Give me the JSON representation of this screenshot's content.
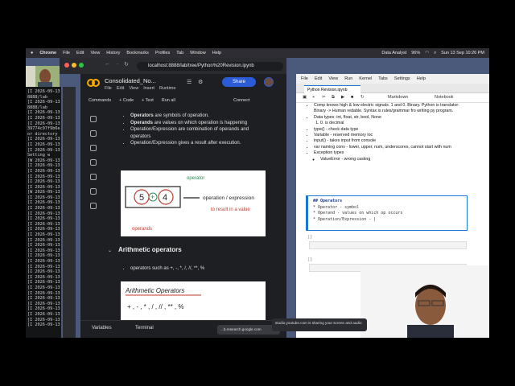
{
  "menubar": {
    "app": "Chrome",
    "items": [
      "File",
      "Edit",
      "View",
      "History",
      "Bookmarks",
      "Profiles",
      "Tab",
      "Window",
      "Help"
    ],
    "right_items": [
      "Data Analyst",
      "96%",
      "Sun 13 Sep 10:26 PM"
    ]
  },
  "chrome": {
    "url": "localhost:8888/lab/tree/Python%20Revision.ipynb"
  },
  "terminal_lines": [
    "[I 2026-09-13",
    "8888/lab",
    "[I 2026-09-13",
    "8888/lab",
    "[I 2026-09-13",
    "[I 2026-09-13",
    "[I 2026-09-13",
    "39774c97f9b6e",
    "  or directory",
    "[I 2026-09-13",
    "[I 2026-09-13",
    "[I 2026-09-13",
    "  Setting w",
    "[W 2026-09-13",
    "[I 2026-09-13",
    "[I 2026-09-13",
    "[I 2026-09-13",
    "[I 2026-09-13",
    "[I 2026-09-13",
    "[W 2026-09-13",
    "[I 2026-09-13",
    "[I 2026-09-13",
    "[I 2026-09-13",
    "[I 2026-09-13",
    "[I 2026-09-13",
    "[I 2026-09-13",
    "[I 2026-09-13",
    "[I 2026-09-13",
    "[I 2026-09-13",
    "[I 2026-09-13",
    "[I 2026-09-13",
    "[I 2026-09-13",
    "[I 2026-09-13",
    "[I 2026-09-13",
    "[I 2026-09-13",
    "[I 2026-09-13",
    "[I 2026-09-13",
    "[I 2026-09-13",
    "[I 2026-09-13",
    "[I 2026-09-13",
    "[I 2026-09-13",
    "[I 2026-09-13",
    "[I 2026-09-13",
    "[I 2026-09-13",
    "[I 2026-09-13"
  ],
  "colab": {
    "title": "Consolidated_No...",
    "menu": [
      "File",
      "Edit",
      "View",
      "Insert",
      "Runtime"
    ],
    "share_label": "Share",
    "toolbar": {
      "commands": "Commands",
      "code": "+ Code",
      "text": "+ Text",
      "run_all": "Run all",
      "connect": "Connect"
    },
    "bullets": [
      [
        "Operators",
        " are symbols of operation."
      ],
      [
        "Operands",
        " are values on which operation is happening"
      ],
      [
        "",
        "Operation/Expression are combination of operands and operators"
      ],
      [
        "",
        "Operation/Expression gives a result after execution."
      ]
    ],
    "heading": "Arithmetic operators",
    "arith_text": "operators such as  +, -, *, /, //, **, %",
    "sketch1": {
      "operator": "operator",
      "operation": "operation / expression",
      "result": "to result in a value",
      "operands": "operands",
      "left": "5",
      "op": "+",
      "right": "4"
    },
    "sketch2": {
      "title": "Arithmetic Operators",
      "ops": "+ , - , * , / , // , ** , %"
    },
    "bottom": {
      "variables": "Variables",
      "terminal": "Terminal"
    }
  },
  "jupyter": {
    "menu": [
      "File",
      "Edit",
      "View",
      "Run",
      "Kernel",
      "Tabs",
      "Settings",
      "Help"
    ],
    "tab": "Python Revision.ipynb",
    "cell_type": "Markdown",
    "kernel": "Notebook",
    "text": [
      "Comp knows high & low electric signals. 1 and 0. Binary. Python is translator: Binary -> Human redable. Syntax is rules/grammar fro writing py program.",
      "Data types: int, float, str, bool, None",
      "0. is decimal",
      "type() - check data type",
      "Variable - reserved memory loc",
      "input() - takes input from console",
      "var naming conv - lower, upper, num, underscores, cannot start with num",
      "Exception types",
      "ValueError - wrong casting"
    ],
    "cell_lines": [
      "## Operators",
      "* Operator - symbol",
      "* Operand - values on which op occurs",
      "* Operation/Expression - |"
    ],
    "empty_prompt": "[ ]:"
  },
  "share_banner": "studio.youtube.com is sharing your screen and audio",
  "research_tab": "...b.research.google.com",
  "colors": {
    "colab_bg": "#1e1f22",
    "accent": "#1976d2",
    "share_btn": "#2c5bd6",
    "red_sketch": "#c0392b",
    "green_sketch": "#2e8b57"
  }
}
